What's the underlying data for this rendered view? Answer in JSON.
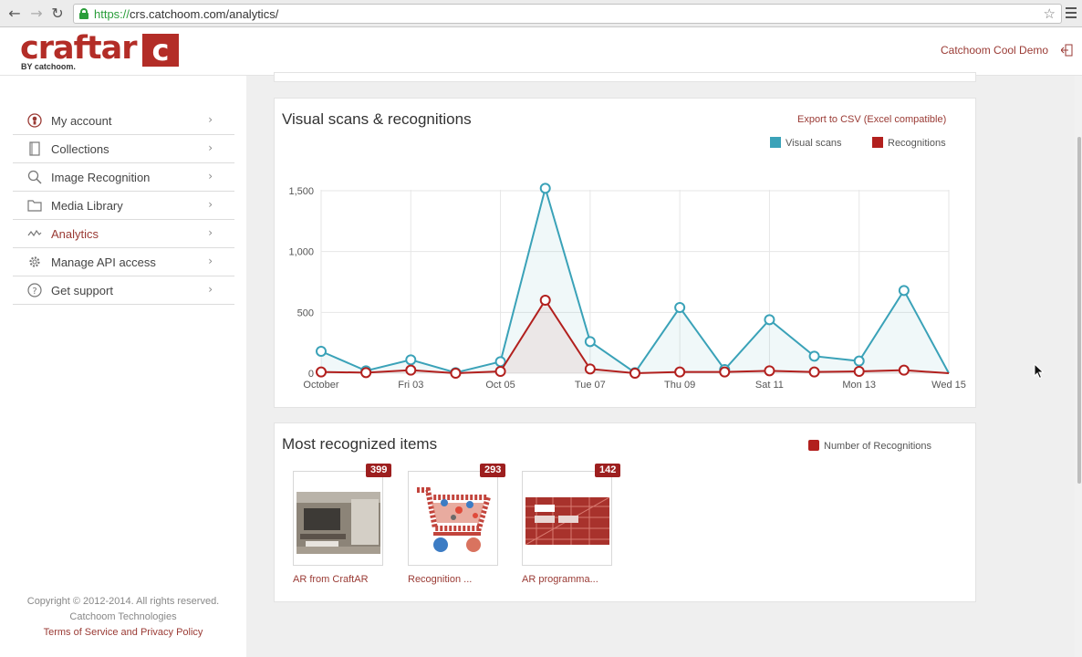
{
  "browser": {
    "url_scheme": "https://",
    "url_rest": "crs.catchoom.com/analytics/"
  },
  "header": {
    "logo_text": "craftar",
    "logo_c": "c",
    "logo_by": "BY catchoom.",
    "account_name": "Catchoom Cool Demo"
  },
  "sidebar": {
    "items": [
      {
        "label": "My account",
        "icon": "account-icon"
      },
      {
        "label": "Collections",
        "icon": "collections-icon"
      },
      {
        "label": "Image Recognition",
        "icon": "search-icon"
      },
      {
        "label": "Media Library",
        "icon": "folder-icon"
      },
      {
        "label": "Analytics",
        "icon": "analytics-icon",
        "active": true
      },
      {
        "label": "Manage API access",
        "icon": "gear-icon"
      },
      {
        "label": "Get support",
        "icon": "help-icon"
      }
    ],
    "footer": {
      "copyright": "Copyright © 2012-2014. All rights reserved.",
      "company": "Catchoom Technologies",
      "terms": "Terms of Service and Privacy Policy"
    }
  },
  "scans_panel": {
    "title": "Visual scans & recognitions",
    "export_label": "Export to CSV (Excel compatible)",
    "legend": [
      {
        "label": "Visual scans",
        "color": "#3aa2b8"
      },
      {
        "label": "Recognitions",
        "color": "#b2201e"
      }
    ]
  },
  "chart_data": {
    "type": "line",
    "x_tick_labels": [
      "October",
      "Fri 03",
      "Oct 05",
      "Tue 07",
      "Thu 09",
      "Sat 11",
      "Mon 13",
      "Wed 15"
    ],
    "y_tick_labels": [
      "0",
      "500",
      "1,000",
      "1,500"
    ],
    "ylim": [
      0,
      1500
    ],
    "grid": true,
    "legend_position": "top-right",
    "series": [
      {
        "name": "Visual scans",
        "color": "#3aa2b8",
        "values": [
          180,
          20,
          110,
          5,
          95,
          1520,
          260,
          5,
          540,
          30,
          440,
          140,
          100,
          680,
          0
        ]
      },
      {
        "name": "Recognitions",
        "color": "#b2201e",
        "values": [
          10,
          5,
          25,
          0,
          15,
          600,
          35,
          0,
          10,
          10,
          20,
          10,
          15,
          25,
          0
        ]
      }
    ]
  },
  "recognized_panel": {
    "title": "Most recognized items",
    "legend_label": "Number of Recognitions",
    "legend_color": "#b2201e",
    "items": [
      {
        "count": "399",
        "label": "AR from CraftAR"
      },
      {
        "count": "293",
        "label": "Recognition ..."
      },
      {
        "count": "142",
        "label": "AR programma..."
      }
    ]
  }
}
